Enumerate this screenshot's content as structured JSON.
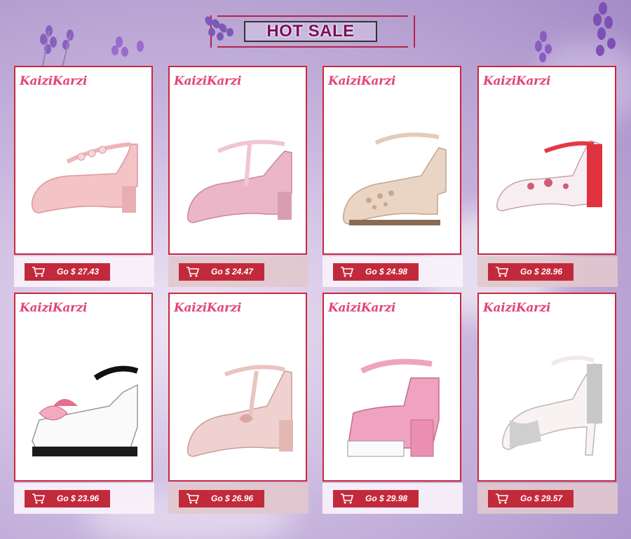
{
  "header": {
    "title": "HOT SALE"
  },
  "colors": {
    "accent": "#c22a3b",
    "card_border": "#c8283e",
    "title": "#7a0f58",
    "logo": "#e2447a"
  },
  "products": [
    {
      "brand": "KaiziKarzi",
      "price_label": "Go $ 27.43",
      "icon": "cart-icon",
      "shoe": "pink-flower-strap-pump"
    },
    {
      "brand": "KaiziKarzi",
      "price_label": "Go $ 24.47",
      "icon": "cart-icon",
      "shoe": "pink-t-strap-pump"
    },
    {
      "brand": "KaiziKarzi",
      "price_label": "Go $ 24.98",
      "icon": "cart-icon",
      "shoe": "beige-cutout-pump"
    },
    {
      "brand": "KaiziKarzi",
      "price_label": "Go $ 28.96",
      "icon": "cart-icon",
      "shoe": "red-floral-peep-toe"
    },
    {
      "brand": "KaiziKarzi",
      "price_label": "Go $ 23.96",
      "icon": "cart-icon",
      "shoe": "bow-wedge-sandal"
    },
    {
      "brand": "KaiziKarzi",
      "price_label": "Go $ 26.96",
      "icon": "cart-icon",
      "shoe": "nude-bow-t-strap"
    },
    {
      "brand": "KaiziKarzi",
      "price_label": "Go $ 29.98",
      "icon": "cart-icon",
      "shoe": "pink-platform-sandal"
    },
    {
      "brand": "KaiziKarzi",
      "price_label": "Go $ 29.57",
      "icon": "cart-icon",
      "shoe": "glitter-peep-toe-heel"
    }
  ]
}
